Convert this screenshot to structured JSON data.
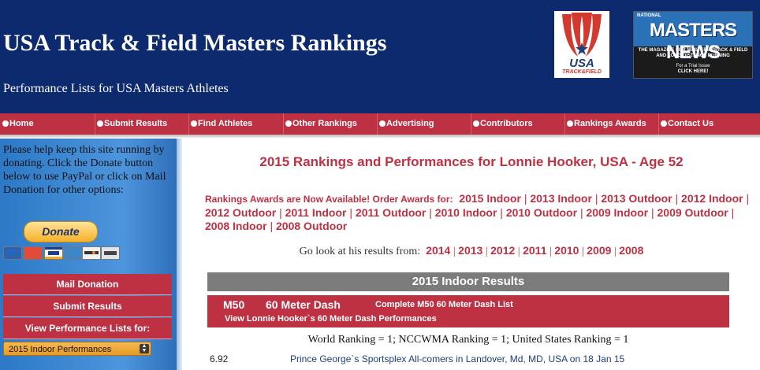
{
  "header": {
    "title": "USA Track & Field Masters Rankings",
    "subtitle": "Performance Lists for USA Masters Athletes",
    "usatf_logo_text": "USA",
    "usatf_logo_sub": "TRACK&FIELD",
    "mn_small": "NATIONAL",
    "mn_name": "MASTERS NEWS",
    "mn_desc": "THE MAGAZINE FOR MASTERS TRACK & FIELD AND LONG DISTANCE RUNNING",
    "mn_trial": "For a Trial Issue",
    "mn_click": "CLICK HERE!"
  },
  "nav": {
    "items": [
      {
        "label": "Home"
      },
      {
        "label": "Submit Results"
      },
      {
        "label": "Find Athletes"
      },
      {
        "label": "Other Rankings"
      },
      {
        "label": "Advertising"
      },
      {
        "label": "Contributors"
      },
      {
        "label": "Rankings Awards"
      },
      {
        "label": "Contact Us"
      }
    ]
  },
  "sidebar": {
    "donate_text": "Please help keep this site running by donating. Click the Donate button below to use PayPal or click on Mail Donation for other options:",
    "donate_label": "Donate",
    "mail_donation": "Mail Donation",
    "submit_results": "Submit Results",
    "view_lists": "View Performance Lists for:",
    "select_value": "2015 Indoor Performances"
  },
  "main": {
    "title": "2015 Rankings and Performances for Lonnie Hooker, USA - Age 52",
    "awards_lead": "Rankings Awards are Now Available! Order Awards for:",
    "awards_links": [
      "2015 Indoor",
      "2013 Indoor",
      "2013 Outdoor",
      "2012 Indoor",
      "2012 Outdoor",
      "2011 Indoor",
      "2011 Outdoor",
      "2010 Indoor",
      "2010 Outdoor",
      "2009 Indoor",
      "2009 Outdoor",
      "2008 Indoor",
      "2008 Outdoor"
    ],
    "goto_lead": "Go look at his results from:",
    "years": [
      "2014",
      "2013",
      "2012",
      "2011",
      "2010",
      "2009",
      "2008"
    ],
    "results_heading": "2015 Indoor Results",
    "event_age": "M50",
    "event_name": "60 Meter Dash",
    "event_list_link": "Complete M50 60 Meter Dash List",
    "event_perf_link": "View Lonnie Hooker`s 60 Meter Dash Performances",
    "rankings_line": "World Ranking = 1; NCCWMA Ranking = 1; United States Ranking = 1",
    "perf_mark": "6.92",
    "perf_meet": "Prince George`s Sportsplex All-comers in Landover, Md, MD, USA on 18 Jan 15"
  },
  "colors": {
    "header_bg": "#0e2a6e",
    "accent_red": "#bd3143",
    "sidebar_blue": "#3f8ad3",
    "results_gray": "#7b7b7b"
  }
}
